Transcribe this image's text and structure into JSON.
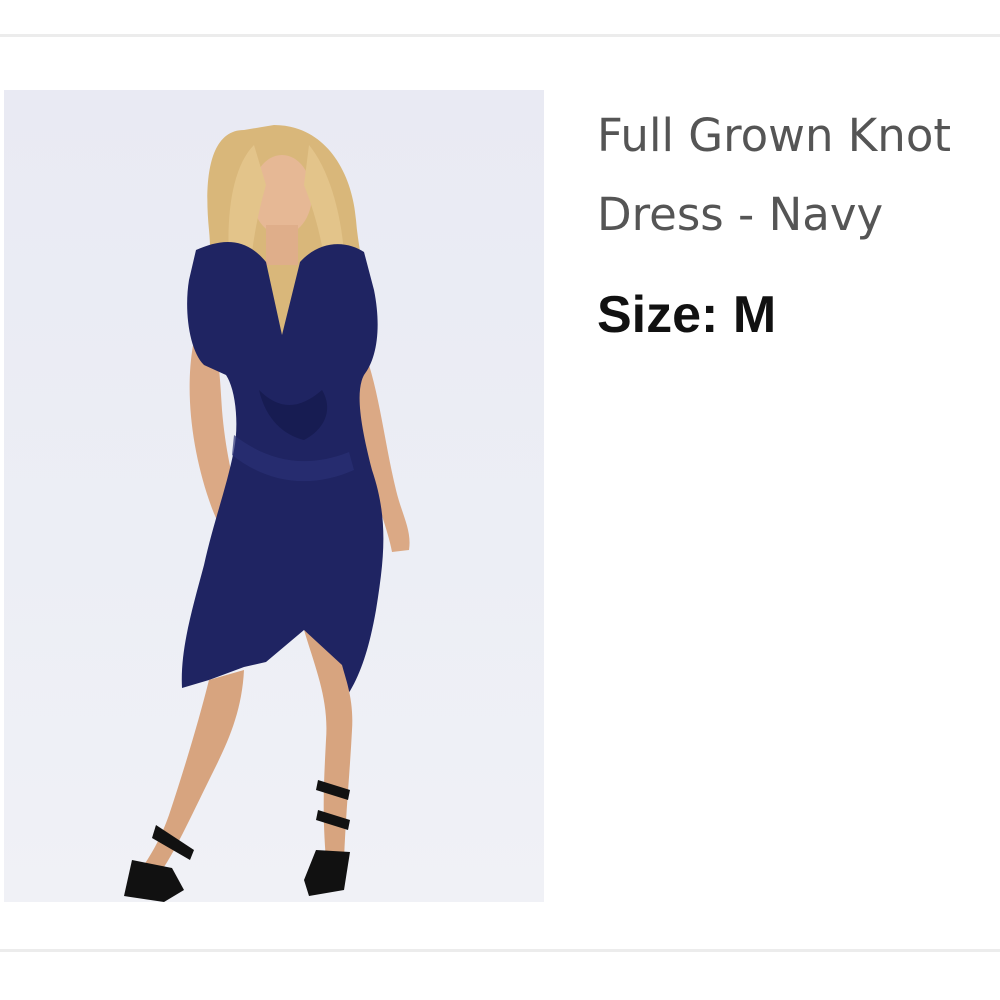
{
  "product": {
    "title_line1": "Full Grown Knot",
    "title_line2": "Dress - Navy",
    "size_label": "Size:",
    "size_value": "M"
  },
  "colors": {
    "background": "#ffffff",
    "divider": "#ececec",
    "title_text": "#555555",
    "size_text": "#111111",
    "dress": "#1f2462"
  }
}
